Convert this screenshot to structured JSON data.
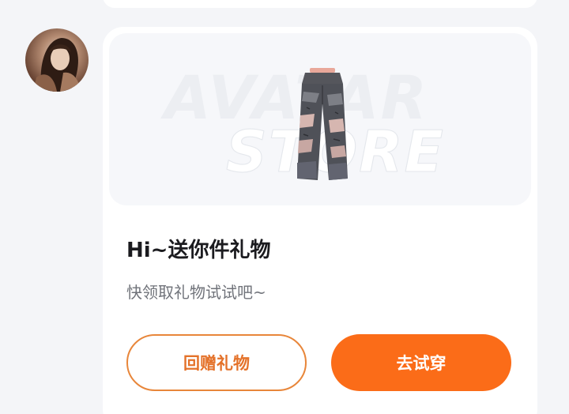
{
  "card": {
    "banner": {
      "watermark_line1": "AVATAR",
      "watermark_line2": "STORE",
      "item_icon": "ripped-jeans-icon"
    },
    "title": "Hi~送你件礼物",
    "subtitle": "快领取礼物试试吧~",
    "buttons": {
      "return_gift_label": "回赠礼物",
      "try_on_label": "去试穿"
    }
  },
  "colors": {
    "page_background": "#f4f5f8",
    "card_background": "#ffffff",
    "accent_orange": "#fb6c18",
    "outline_orange": "#e8863a",
    "title_text": "#1b1b1f",
    "subtitle_text": "#70737a"
  }
}
